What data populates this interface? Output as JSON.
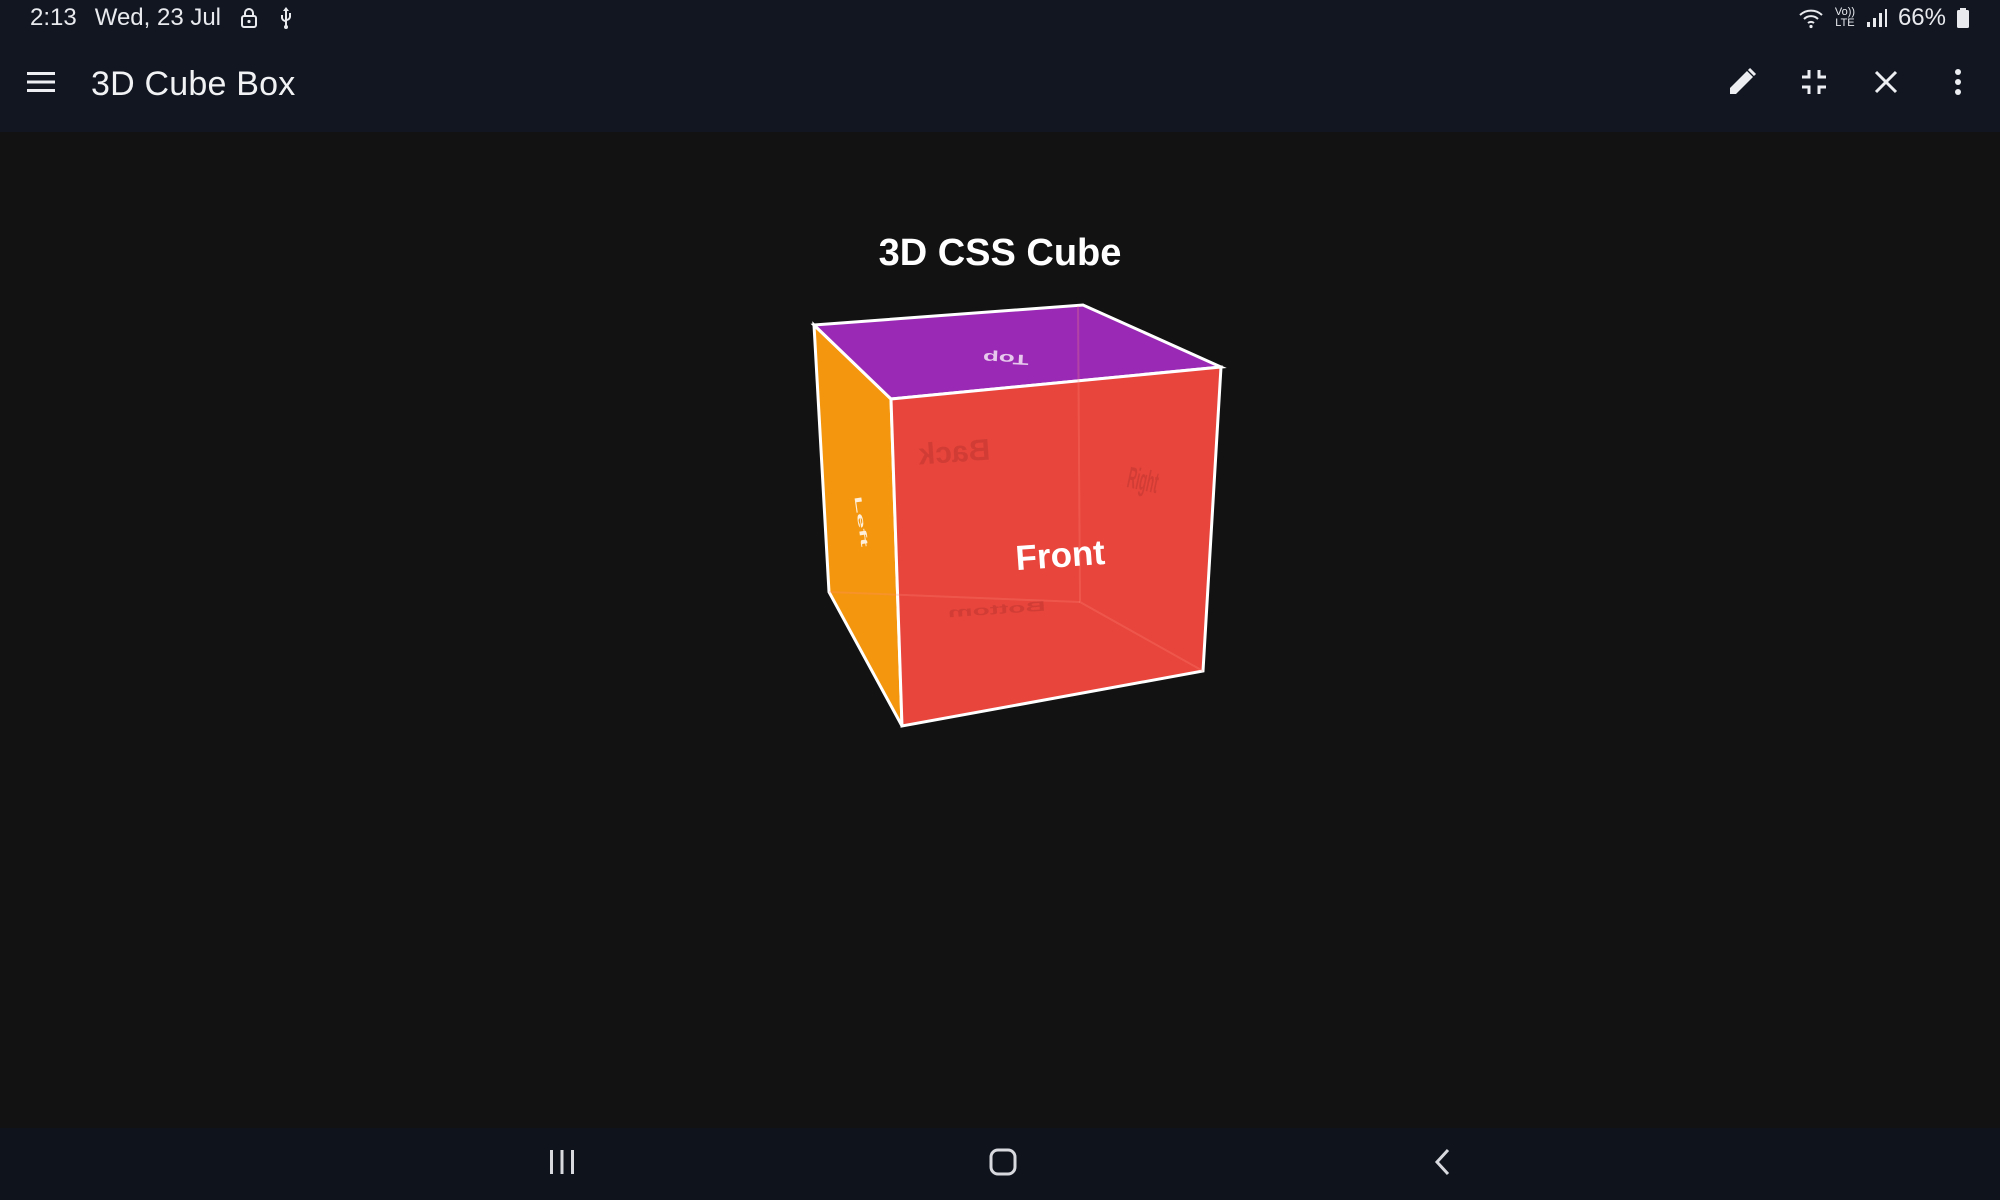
{
  "status_bar": {
    "time": "2:13",
    "date": "Wed, 23 Jul",
    "battery": "66%",
    "volte_label": "Vo)) LTE",
    "icons": [
      "lock-icon",
      "usb-icon",
      "wifi-icon",
      "volte-icon",
      "signal-icon",
      "battery-icon"
    ]
  },
  "app_bar": {
    "title": "3D Cube Box",
    "actions": [
      "edit-icon",
      "exit-fullscreen-icon",
      "close-icon",
      "more-vert-icon"
    ]
  },
  "scene": {
    "title": "3D CSS Cube",
    "faces": {
      "front": "Front",
      "back": "Back",
      "top": "Top",
      "bottom": "Bottom",
      "left": "Left",
      "right": "Right"
    },
    "colors": {
      "front": "#e8453c",
      "top": "#9a2ab5",
      "left": "#f4960e",
      "edge": "#ffffff"
    }
  },
  "nav_bar": {
    "buttons": [
      "recent-apps-icon",
      "home-icon",
      "back-icon"
    ]
  }
}
